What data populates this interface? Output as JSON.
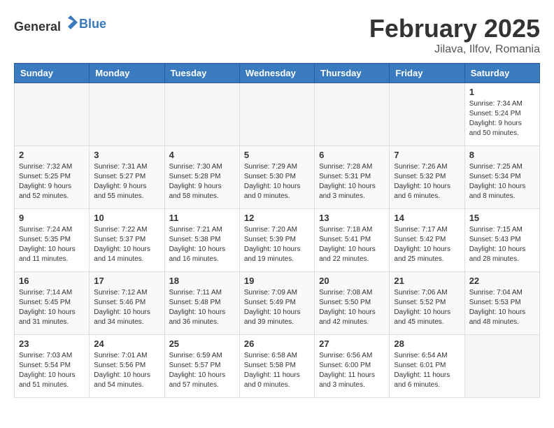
{
  "logo": {
    "text_general": "General",
    "text_blue": "Blue"
  },
  "title": "February 2025",
  "subtitle": "Jilava, Ilfov, Romania",
  "days_of_week": [
    "Sunday",
    "Monday",
    "Tuesday",
    "Wednesday",
    "Thursday",
    "Friday",
    "Saturday"
  ],
  "weeks": [
    [
      {
        "day": "",
        "info": ""
      },
      {
        "day": "",
        "info": ""
      },
      {
        "day": "",
        "info": ""
      },
      {
        "day": "",
        "info": ""
      },
      {
        "day": "",
        "info": ""
      },
      {
        "day": "",
        "info": ""
      },
      {
        "day": "1",
        "info": "Sunrise: 7:34 AM\nSunset: 5:24 PM\nDaylight: 9 hours\nand 50 minutes."
      }
    ],
    [
      {
        "day": "2",
        "info": "Sunrise: 7:32 AM\nSunset: 5:25 PM\nDaylight: 9 hours\nand 52 minutes."
      },
      {
        "day": "3",
        "info": "Sunrise: 7:31 AM\nSunset: 5:27 PM\nDaylight: 9 hours\nand 55 minutes."
      },
      {
        "day": "4",
        "info": "Sunrise: 7:30 AM\nSunset: 5:28 PM\nDaylight: 9 hours\nand 58 minutes."
      },
      {
        "day": "5",
        "info": "Sunrise: 7:29 AM\nSunset: 5:30 PM\nDaylight: 10 hours\nand 0 minutes."
      },
      {
        "day": "6",
        "info": "Sunrise: 7:28 AM\nSunset: 5:31 PM\nDaylight: 10 hours\nand 3 minutes."
      },
      {
        "day": "7",
        "info": "Sunrise: 7:26 AM\nSunset: 5:32 PM\nDaylight: 10 hours\nand 6 minutes."
      },
      {
        "day": "8",
        "info": "Sunrise: 7:25 AM\nSunset: 5:34 PM\nDaylight: 10 hours\nand 8 minutes."
      }
    ],
    [
      {
        "day": "9",
        "info": "Sunrise: 7:24 AM\nSunset: 5:35 PM\nDaylight: 10 hours\nand 11 minutes."
      },
      {
        "day": "10",
        "info": "Sunrise: 7:22 AM\nSunset: 5:37 PM\nDaylight: 10 hours\nand 14 minutes."
      },
      {
        "day": "11",
        "info": "Sunrise: 7:21 AM\nSunset: 5:38 PM\nDaylight: 10 hours\nand 16 minutes."
      },
      {
        "day": "12",
        "info": "Sunrise: 7:20 AM\nSunset: 5:39 PM\nDaylight: 10 hours\nand 19 minutes."
      },
      {
        "day": "13",
        "info": "Sunrise: 7:18 AM\nSunset: 5:41 PM\nDaylight: 10 hours\nand 22 minutes."
      },
      {
        "day": "14",
        "info": "Sunrise: 7:17 AM\nSunset: 5:42 PM\nDaylight: 10 hours\nand 25 minutes."
      },
      {
        "day": "15",
        "info": "Sunrise: 7:15 AM\nSunset: 5:43 PM\nDaylight: 10 hours\nand 28 minutes."
      }
    ],
    [
      {
        "day": "16",
        "info": "Sunrise: 7:14 AM\nSunset: 5:45 PM\nDaylight: 10 hours\nand 31 minutes."
      },
      {
        "day": "17",
        "info": "Sunrise: 7:12 AM\nSunset: 5:46 PM\nDaylight: 10 hours\nand 34 minutes."
      },
      {
        "day": "18",
        "info": "Sunrise: 7:11 AM\nSunset: 5:48 PM\nDaylight: 10 hours\nand 36 minutes."
      },
      {
        "day": "19",
        "info": "Sunrise: 7:09 AM\nSunset: 5:49 PM\nDaylight: 10 hours\nand 39 minutes."
      },
      {
        "day": "20",
        "info": "Sunrise: 7:08 AM\nSunset: 5:50 PM\nDaylight: 10 hours\nand 42 minutes."
      },
      {
        "day": "21",
        "info": "Sunrise: 7:06 AM\nSunset: 5:52 PM\nDaylight: 10 hours\nand 45 minutes."
      },
      {
        "day": "22",
        "info": "Sunrise: 7:04 AM\nSunset: 5:53 PM\nDaylight: 10 hours\nand 48 minutes."
      }
    ],
    [
      {
        "day": "23",
        "info": "Sunrise: 7:03 AM\nSunset: 5:54 PM\nDaylight: 10 hours\nand 51 minutes."
      },
      {
        "day": "24",
        "info": "Sunrise: 7:01 AM\nSunset: 5:56 PM\nDaylight: 10 hours\nand 54 minutes."
      },
      {
        "day": "25",
        "info": "Sunrise: 6:59 AM\nSunset: 5:57 PM\nDaylight: 10 hours\nand 57 minutes."
      },
      {
        "day": "26",
        "info": "Sunrise: 6:58 AM\nSunset: 5:58 PM\nDaylight: 11 hours\nand 0 minutes."
      },
      {
        "day": "27",
        "info": "Sunrise: 6:56 AM\nSunset: 6:00 PM\nDaylight: 11 hours\nand 3 minutes."
      },
      {
        "day": "28",
        "info": "Sunrise: 6:54 AM\nSunset: 6:01 PM\nDaylight: 11 hours\nand 6 minutes."
      },
      {
        "day": "",
        "info": ""
      }
    ]
  ]
}
